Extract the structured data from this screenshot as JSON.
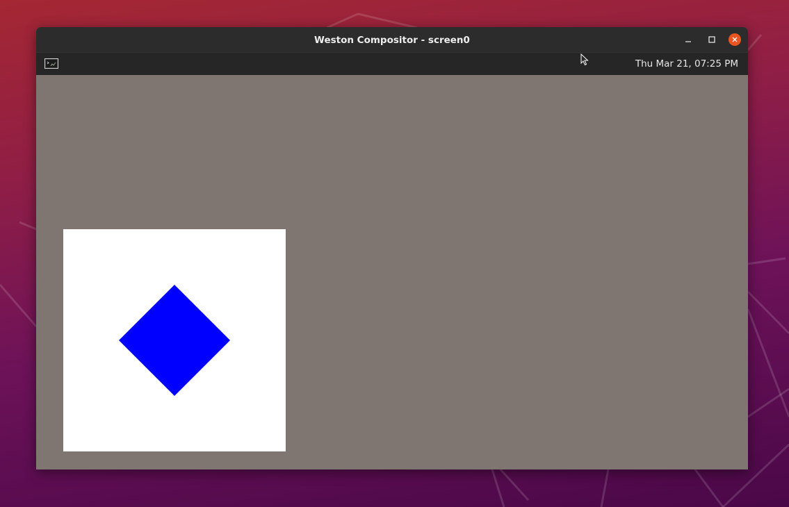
{
  "window": {
    "title": "Weston Compositor - screen0"
  },
  "panel": {
    "launcher_icon": "terminal-icon",
    "clock": "Thu Mar 21, 07:25 PM"
  },
  "controls": {
    "minimize_icon": "minimize-icon",
    "maximize_icon": "maximize-icon",
    "close_icon": "close-icon"
  },
  "colors": {
    "workspace_background": "#7f7672",
    "close_button": "#e95420",
    "client_background": "#ffffff",
    "diamond_fill": "#0000ff"
  }
}
